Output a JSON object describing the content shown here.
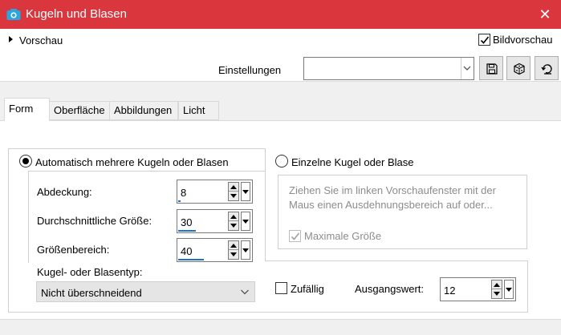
{
  "window": {
    "title": "Kugeln und Blasen",
    "close_label": "✕"
  },
  "top": {
    "preview_label": "Vorschau",
    "bildvorschau_label": "Bildvorschau",
    "bildvorschau_checked": true,
    "einstellungen_label": "Einstellungen",
    "einstellungen_value": ""
  },
  "tabs": [
    {
      "label": "Form",
      "active": true
    },
    {
      "label": "Oberfläche",
      "active": false
    },
    {
      "label": "Abbildungen",
      "active": false
    },
    {
      "label": "Licht",
      "active": false
    }
  ],
  "form": {
    "auto_label": "Automatisch mehrere Kugeln oder Blasen",
    "auto_selected": true,
    "single_label": "Einzelne Kugel oder Blase",
    "single_selected": false,
    "fields": {
      "abdeckung": {
        "label": "Abdeckung:",
        "value": "8",
        "level": 0.05
      },
      "durchschnitt": {
        "label": "Durchschnittliche Größe:",
        "value": "30",
        "level": 0.36
      },
      "groessenbereich": {
        "label": "Größenbereich:",
        "value": "40",
        "level": 0.52
      }
    },
    "typ_label": "Kugel- oder Blasentyp:",
    "typ_value": "Nicht überschneidend",
    "single_text": "Ziehen Sie im linken Vorschaufenster mit der Maus einen Ausdehnungsbereich auf oder...",
    "max_label": "Maximale Größe",
    "max_checked": true,
    "zufaellig_label": "Zufällig",
    "zufaellig_checked": false,
    "ausgang_label": "Ausgangswert:",
    "ausgang_value": "12"
  },
  "colors": {
    "titlebar": "#d9363e",
    "accent": "#1a73c9"
  }
}
